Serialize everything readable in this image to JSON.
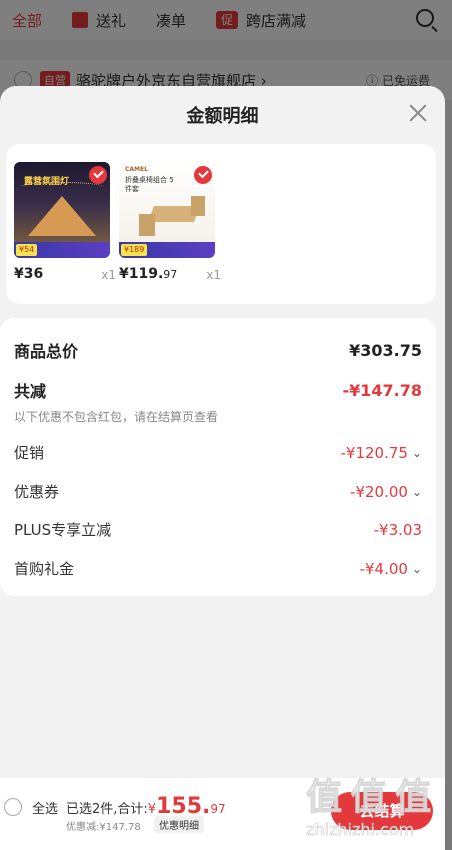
{
  "background": {
    "tabs": [
      {
        "label": "全部",
        "active": true
      },
      {
        "label": "送礼",
        "icon": "gift-icon"
      },
      {
        "label": "凑单"
      },
      {
        "label": "跨店满减",
        "badge": "促"
      }
    ],
    "search_icon": "search-icon",
    "store": {
      "badge": "自营",
      "name": "骆驼牌户外京东自营旗舰店 ›",
      "shipping": "ⓘ 已免运费"
    }
  },
  "sheet": {
    "title": "金额明细",
    "close_icon": "close-icon",
    "products": [
      {
        "image_caption": "露营氛围灯",
        "strip_price": "¥54",
        "price_yuan": "¥36",
        "price_cents": "",
        "qty": "x1"
      },
      {
        "image_brand": "CAMEL",
        "image_caption": "折叠桌椅组合 5件套",
        "strip_price": "¥189",
        "price_yuan": "¥119.",
        "price_cents": "97",
        "qty": "x1"
      }
    ],
    "details": {
      "subtotal_label": "商品总价",
      "subtotal_value": "¥303.75",
      "total_discount_label": "共减",
      "total_discount_value": "-¥147.78",
      "hint": "以下优惠不包含红包，请在结算页查看",
      "items": [
        {
          "label": "促销",
          "value": "-¥120.75",
          "expandable": true
        },
        {
          "label": "优惠券",
          "value": "-¥20.00",
          "expandable": true
        },
        {
          "label": "PLUS专享立减",
          "value": "-¥3.03",
          "expandable": false
        },
        {
          "label": "首购礼金",
          "value": "-¥4.00",
          "expandable": true
        }
      ]
    }
  },
  "footer": {
    "select_all": "全选",
    "selected_text": "已选2件,合计:",
    "total_prefix": "¥",
    "total_main": "155.",
    "total_cents": "97",
    "discount_text": "优惠减:¥147.78",
    "detail_button": "优惠明细",
    "checkout_button": "去结算"
  },
  "watermark": {
    "mark": "值 值 值",
    "text": "zhizhizhi.com"
  },
  "colors": {
    "accent": "#e4393c",
    "sheet_bg": "#f2f2f2",
    "card_bg": "#ffffff"
  }
}
